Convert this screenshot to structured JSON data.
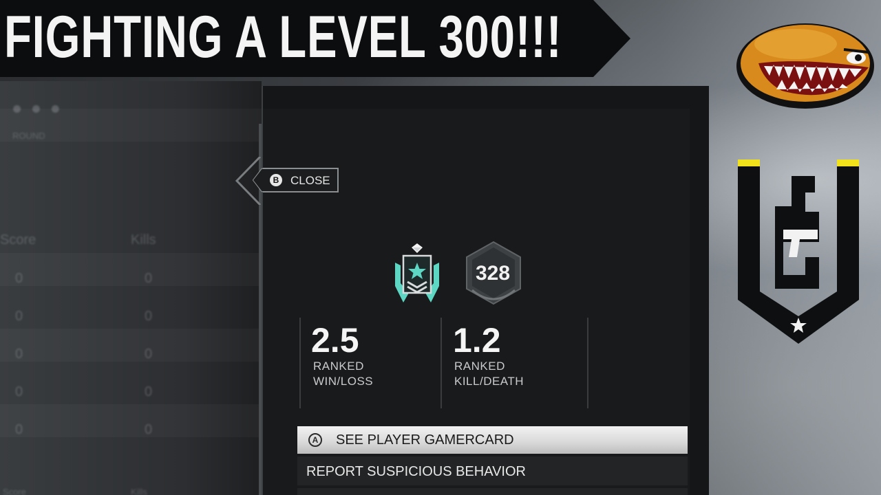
{
  "title_banner": {
    "text": "FIGHTING A LEVEL 300!!!"
  },
  "scoreboard_background": {
    "header_text": "ROUND",
    "columns": [
      "Score",
      "Kills"
    ],
    "rows": [
      [
        "0",
        "0"
      ],
      [
        "0",
        "0"
      ],
      [
        "0",
        "0"
      ],
      [
        "0",
        "0"
      ],
      [
        "0",
        "0"
      ]
    ],
    "footer_columns": [
      "Score",
      "Kills"
    ]
  },
  "player_panel": {
    "close_button": {
      "glyph": "B",
      "label": "CLOSE"
    },
    "rank_badge_icon": "diamond-rank-icon",
    "level": "328",
    "stats": [
      {
        "value": "2.5",
        "label_line1": "RANKED",
        "label_line2": "WIN/LOSS"
      },
      {
        "value": "1.2",
        "label_line1": "RANKED",
        "label_line2": "KILL/DEATH"
      }
    ],
    "menu": [
      {
        "glyph": "A",
        "label": "SEE PLAYER GAMERCARD",
        "selected": true
      },
      {
        "label": "REPORT SUSPICIOUS BEHAVIOR",
        "selected": false
      }
    ]
  },
  "logos": {
    "mascot": "shark-mouth-lemon-logo",
    "game": "rainbow-six-siege-logo"
  },
  "colors": {
    "rank_teal": "#5ed6c4",
    "siege_yellow": "#f2e21b",
    "mascot_orange": "#d98a1c"
  }
}
